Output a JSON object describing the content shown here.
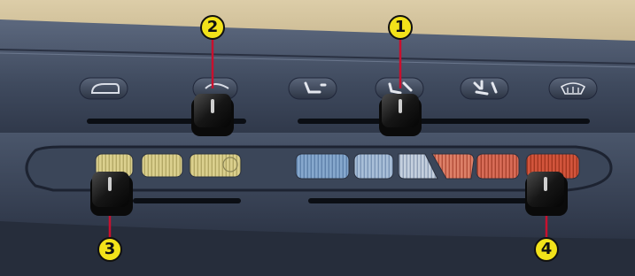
{
  "panel": {
    "colors": {
      "dash_top": "#d8c9a4",
      "panel_dark": "#1e2433",
      "panel_mid": "#3a4558",
      "panel_light": "#58647a",
      "knob": "#141414",
      "callout_fill": "#f2e21a",
      "pointer_line": "#c8102e"
    },
    "mode_buttons": [
      {
        "icon": "recirculation-icon"
      },
      {
        "icon": "fresh-air-icon"
      },
      {
        "icon": "face-vent-icon"
      },
      {
        "icon": "face-feet-vent-icon"
      },
      {
        "icon": "feet-defrost-icon"
      },
      {
        "icon": "windshield-defrost-icon"
      }
    ],
    "fan_stages": [
      {
        "icon": "fan-speed-1",
        "color": "#d8cc86"
      },
      {
        "icon": "fan-speed-2",
        "color": "#d8cc86"
      },
      {
        "icon": "fan-speed-max",
        "color": "#d8cc86"
      }
    ],
    "temp_stages": [
      {
        "icon": "cold-3",
        "color": "#7ea1c7"
      },
      {
        "icon": "cold-2",
        "color": "#9cb4d0"
      },
      {
        "icon": "cold-1",
        "color": "#b8c6d8"
      },
      {
        "icon": "warm-1",
        "color": "#d1705a"
      },
      {
        "icon": "warm-2",
        "color": "#d46a55"
      },
      {
        "icon": "warm-3",
        "color": "#d4553c"
      }
    ]
  },
  "callouts": {
    "c1": "1",
    "c2": "2",
    "c3": "3",
    "c4": "4"
  }
}
